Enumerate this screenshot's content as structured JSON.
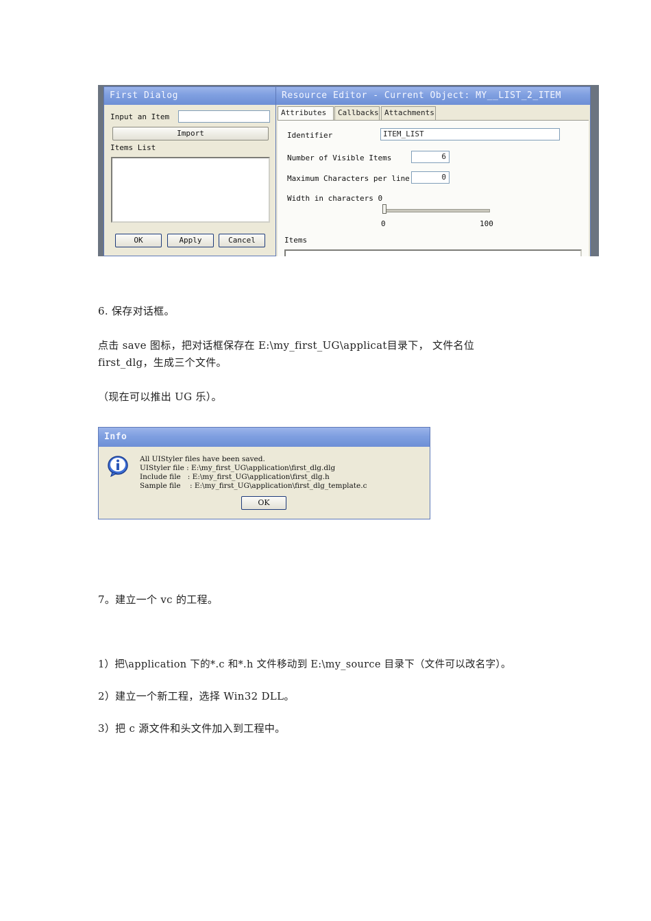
{
  "shot1": {
    "first_dialog": {
      "title": "First Dialog",
      "input_label": "Input an Item",
      "import_label": "Import",
      "items_list_label": "Items List",
      "ok_label": "OK",
      "apply_label": "Apply",
      "cancel_label": "Cancel"
    },
    "resource_editor": {
      "title": "Resource Editor - Current Object: MY__LIST_2_ITEM",
      "tabs": [
        "Attributes",
        "Callbacks",
        "Attachments"
      ],
      "identifier_label": "Identifier",
      "identifier_value": "ITEM_LIST",
      "visible_items_label": "Number of Visible Items",
      "visible_items_value": "6",
      "max_chars_label": "Maximum Characters per line",
      "max_chars_value": "0",
      "width_label": "Width in characters 0",
      "slider_min": "0",
      "slider_max": "100",
      "slider_level": 0,
      "items_label": "Items"
    }
  },
  "paragraphs": {
    "step6": "6. 保存对话框。",
    "p1_line1": "点击 save 图标，把对话框保存在 E:\\my_first_UG\\applicat目录下， 文件名位",
    "p1_line2": "first_dlg，生成三个文件。",
    "note": "（现在可以推出 UG 乐）。",
    "step7": "7。建立一个 vc 的工程。",
    "s1": "1）把\\application 下的*.c 和*.h 文件移动到 E:\\my_source 目录下（文件可以改名字）。",
    "s2": "2）建立一个新工程，选择 Win32 DLL。",
    "s3": "3）把 c 源文件和头文件加入到工程中。"
  },
  "info_dialog": {
    "title": "Info",
    "line1": "All UIStyler files have been saved.",
    "line2": "UIStyler file : E:\\my_first_UG\\application\\first_dlg.dlg",
    "line3": "Include file   : E:\\my_first_UG\\application\\first_dlg.h",
    "line4": "Sample file    : E:\\my_first_UG\\application\\first_dlg_template.c",
    "ok_label": "OK",
    "icon": "info-icon"
  }
}
